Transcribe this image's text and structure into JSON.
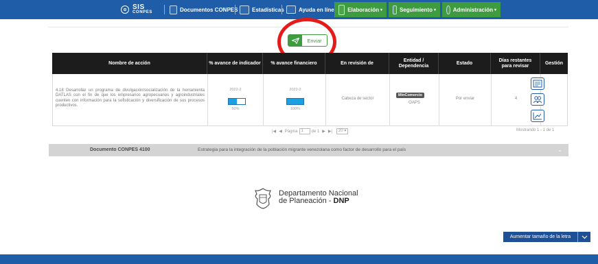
{
  "nav": {
    "logo_top": "SIS",
    "logo_bottom": "CONPES",
    "documentos": "Documentos CONPES",
    "estadisticas": "Estadísticas",
    "ayuda": "Ayuda en línea",
    "elaboracion": "Elaboración",
    "seguimiento": "Seguimiento",
    "administracion": "Administración"
  },
  "send_button": {
    "label": "Enviar"
  },
  "table": {
    "headers": {
      "accion": "Nombre de acción",
      "indicador": "% avance de indicador",
      "financiero": "% avance financiero",
      "revision": "En revisión de",
      "entidad": "Entidad / Dependencia",
      "estado": "Estado",
      "dias": "Días restantes para revisar",
      "gestion": "Gestión"
    },
    "row": {
      "accion": "4.18 Desarrollar un programa de divulgación/socialización de la herramienta DATLAS con el fin de que los empresarios agropecuarios y agroindustriales cuenten con información para la sofisticación y diversificación de sus procesos productivos.",
      "indicador_year": "2022-2",
      "indicador_pct": "50%",
      "indicador_value": 50,
      "financiero_year": "2022-2",
      "financiero_pct": "100%",
      "financiero_value": 100,
      "revision": "Cabeza de sector",
      "entidad_badge": "MinComercio",
      "dependencia": "OAPS",
      "estado": "Por enviar",
      "dias": "4"
    }
  },
  "pager": {
    "pagina": "Página",
    "page": "1",
    "de": "de 1",
    "size": "20",
    "mostrando": "Mostrando 1 - 1 de 1"
  },
  "document": {
    "title": "Documento CONPES 4100",
    "description": "Estrategia para la integración de la población migrante venezolana como factor de desarrollo para el país"
  },
  "dnp": {
    "line1": "Departamento Nacional",
    "line2a": "de Planeación - ",
    "line2b": "DNP"
  },
  "font_button": {
    "label": "Aumentar tamaño de la letra"
  },
  "colors": {
    "nav_blue": "#1f5da8",
    "green": "#3f9b3f",
    "highlight_red": "#e51a1a"
  }
}
